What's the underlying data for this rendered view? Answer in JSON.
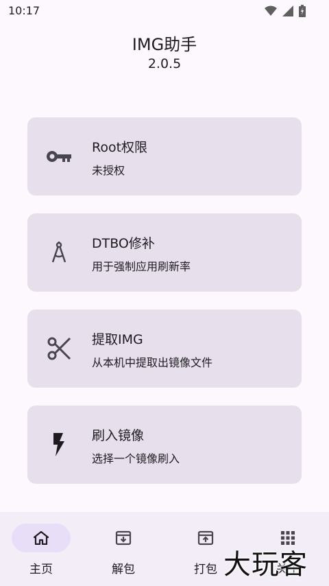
{
  "status_bar": {
    "time": "10:17"
  },
  "app": {
    "title": "IMG助手",
    "version": "2.0.5"
  },
  "cards": [
    {
      "title": "Root权限",
      "subtitle": "未授权",
      "icon": "key-icon"
    },
    {
      "title": "DTBO修补",
      "subtitle": "用于强制应用刷新率",
      "icon": "compass-icon"
    },
    {
      "title": "提取IMG",
      "subtitle": "从本机中提取出镜像文件",
      "icon": "scissors-icon"
    },
    {
      "title": "刷入镜像",
      "subtitle": "选择一个镜像刷入",
      "icon": "flash-icon"
    }
  ],
  "bottom_nav": [
    {
      "label": "主页",
      "icon": "home-icon",
      "active": true
    },
    {
      "label": "解包",
      "icon": "archive-down-icon",
      "active": false
    },
    {
      "label": "打包",
      "icon": "archive-up-icon",
      "active": false
    },
    {
      "label": "关于",
      "icon": "grid-icon",
      "active": false
    }
  ],
  "watermark": "大玩客",
  "colors": {
    "background": "#fdf8fd",
    "card": "#e7e0ec",
    "nav_bg": "#f3edf7",
    "nav_active": "#e8def8",
    "icon": "#49454f"
  }
}
